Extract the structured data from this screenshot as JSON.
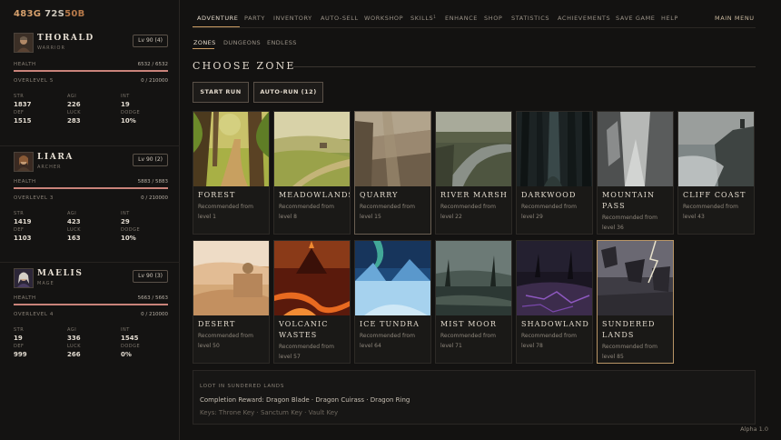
{
  "currency": {
    "gold": "483G",
    "silver": "72S",
    "bronze": "50B"
  },
  "characters": [
    {
      "name": "THORALD",
      "class": "WARRIOR",
      "level": "Lv 90 (4)",
      "health_label": "HEALTH",
      "health": "6532 / 6532",
      "health_fraction": 1.0,
      "overlevel_label": "OVERLEVEL 5",
      "overlevel": "0 / 210000",
      "stats": [
        [
          "STR",
          "1837"
        ],
        [
          "AGI",
          "226"
        ],
        [
          "INT",
          "19"
        ],
        [
          "DEF",
          "1515"
        ],
        [
          "LUCK",
          "283"
        ],
        [
          "DODGE",
          "10%"
        ]
      ]
    },
    {
      "name": "LIARA",
      "class": "ARCHER",
      "level": "Lv 90 (2)",
      "health_label": "HEALTH",
      "health": "5883 / 5883",
      "health_fraction": 1.0,
      "overlevel_label": "OVERLEVEL 3",
      "overlevel": "0 / 210000",
      "stats": [
        [
          "STR",
          "1419"
        ],
        [
          "AGI",
          "423"
        ],
        [
          "INT",
          "29"
        ],
        [
          "DEF",
          "1103"
        ],
        [
          "LUCK",
          "163"
        ],
        [
          "DODGE",
          "10%"
        ]
      ]
    },
    {
      "name": "MAELIS",
      "class": "MAGE",
      "level": "Lv 90 (3)",
      "health_label": "HEALTH",
      "health": "5663 / 5663",
      "health_fraction": 1.0,
      "overlevel_label": "OVERLEVEL 4",
      "overlevel": "0 / 210000",
      "stats": [
        [
          "STR",
          "19"
        ],
        [
          "AGI",
          "336"
        ],
        [
          "INT",
          "1545"
        ],
        [
          "DEF",
          "999"
        ],
        [
          "LUCK",
          "266"
        ],
        [
          "DODGE",
          "0%"
        ]
      ]
    }
  ],
  "nav": {
    "items": [
      "ADVENTURE",
      "PARTY",
      "INVENTORY",
      "AUTO-SELL",
      "WORKSHOP",
      "SKILLS",
      "ENHANCE",
      "SHOP",
      "STATISTICS",
      "ACHIEVEMENTS",
      "SAVE GAME",
      "HELP"
    ],
    "skills_badge": "1",
    "main_menu": "MAIN MENU"
  },
  "subtabs": [
    "ZONES",
    "DUNGEONS",
    "ENDLESS"
  ],
  "section_title": "CHOOSE ZONE",
  "buttons": {
    "start_run": "START RUN",
    "auto_run": "AUTO-RUN (12)"
  },
  "zones": [
    {
      "name": "FOREST",
      "rec1": "Recommended from",
      "rec2": "level 1"
    },
    {
      "name": "MEADOWLANDS",
      "rec1": "Recommended from",
      "rec2": "level 8"
    },
    {
      "name": "QUARRY",
      "rec1": "Recommended from",
      "rec2": "level 15"
    },
    {
      "name": "RIVER MARSH",
      "rec1": "Recommended from",
      "rec2": "level 22"
    },
    {
      "name": "DARKWOOD",
      "rec1": "Recommended from",
      "rec2": "level 29"
    },
    {
      "name": "MOUNTAIN",
      "name2": "PASS",
      "rec1": "Recommended from",
      "rec2": "level 36"
    },
    {
      "name": "CLIFF COAST",
      "rec1": "Recommended from",
      "rec2": "level 43"
    },
    {
      "name": "DESERT",
      "rec1": "Recommended from",
      "rec2": "level 50"
    },
    {
      "name": "VOLCANIC",
      "name2": "WASTES",
      "rec1": "Recommended from",
      "rec2": "level 57"
    },
    {
      "name": "ICE TUNDRA",
      "rec1": "Recommended from",
      "rec2": "level 64"
    },
    {
      "name": "MIST MOOR",
      "rec1": "Recommended from",
      "rec2": "level 71"
    },
    {
      "name": "SHADOWLAND",
      "rec1": "Recommended from",
      "rec2": "level 78"
    },
    {
      "name": "SUNDERED",
      "name2": "LANDS",
      "rec1": "Recommended from",
      "rec2": "level 85"
    }
  ],
  "loot": {
    "title": "LOOT IN SUNDERED LANDS",
    "line1": "Completion Reward: Dragon Blade · Dragon Cuirass · Dragon Ring",
    "line2": "Keys: Throne Key · Sanctum Key · Vault Key"
  },
  "version": "Alpha 1.0",
  "colors": {
    "accent": "#c89a62",
    "health_bar": "#c9837a",
    "gold": "#d6a06c"
  }
}
